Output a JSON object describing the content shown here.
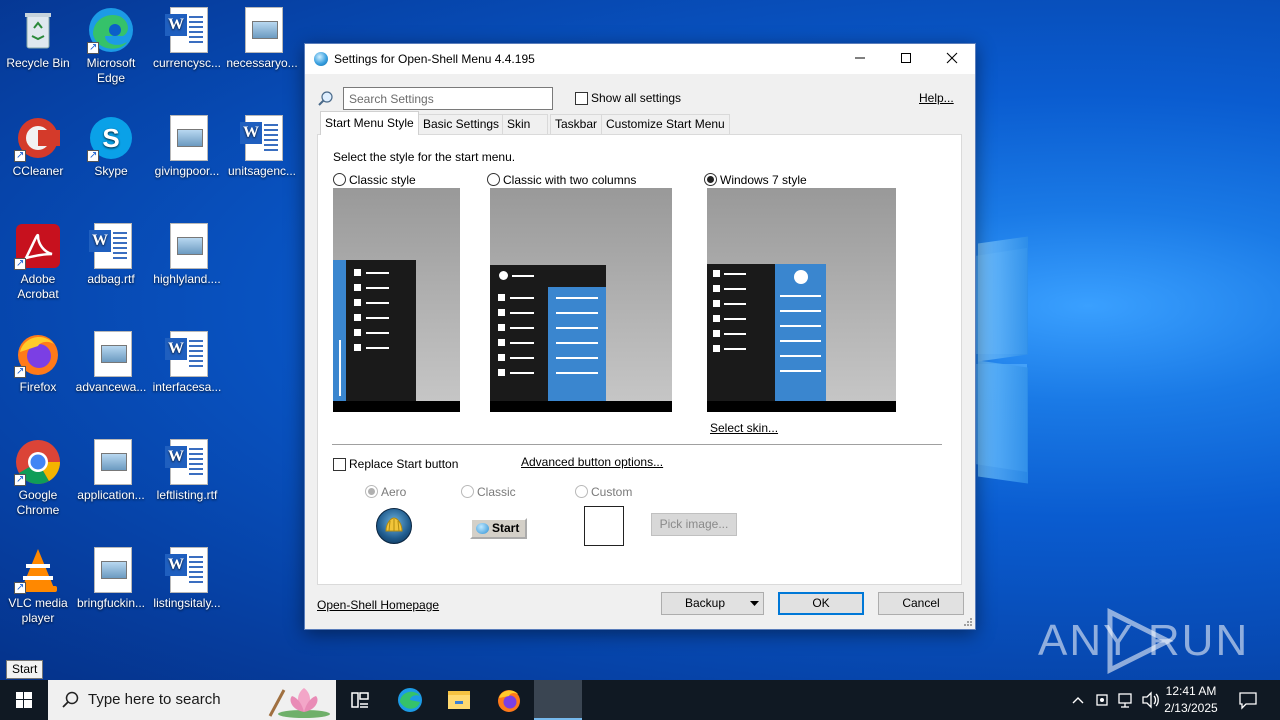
{
  "desktop": {
    "icons": [
      {
        "label": "Recycle Bin"
      },
      {
        "label": "Microsoft Edge"
      },
      {
        "label": "currencysc..."
      },
      {
        "label": "necessaryo..."
      },
      {
        "label": "CCleaner"
      },
      {
        "label": "Skype"
      },
      {
        "label": "givingpoor..."
      },
      {
        "label": "unitsagenc..."
      },
      {
        "label": "Adobe Acrobat"
      },
      {
        "label": "adbag.rtf"
      },
      {
        "label": "highlyland...."
      },
      {
        "label": "Firefox"
      },
      {
        "label": "advancewa..."
      },
      {
        "label": "interfacesa..."
      },
      {
        "label": "Google Chrome"
      },
      {
        "label": "application..."
      },
      {
        "label": "leftlisting.rtf"
      },
      {
        "label": "VLC media player"
      },
      {
        "label": "bringfuckin..."
      },
      {
        "label": "listingsitaly..."
      }
    ],
    "watermark": "ANY RUN"
  },
  "tooltip": {
    "start": "Start"
  },
  "taskbar": {
    "search_placeholder": "Type here to search",
    "clock_time": "12:41 AM",
    "clock_date": "2/13/2025"
  },
  "dialog": {
    "title": "Settings for Open-Shell Menu 4.4.195",
    "search_placeholder": "Search Settings",
    "show_all_settings": "Show all settings",
    "help": "Help...",
    "tabs": [
      {
        "label": "Start Menu Style"
      },
      {
        "label": "Basic Settings"
      },
      {
        "label": "Skin"
      },
      {
        "label": "Taskbar"
      },
      {
        "label": "Customize Start Menu"
      }
    ],
    "selected_tab": "Start Menu Style",
    "prompt": "Select the style for the start menu.",
    "styles": [
      {
        "label": "Classic style",
        "checked": false
      },
      {
        "label": "Classic with two columns",
        "checked": false
      },
      {
        "label": "Windows 7 style",
        "checked": true
      }
    ],
    "select_skin": "Select skin...",
    "replace_start_button": "Replace Start button",
    "advanced_button_options": "Advanced button options...",
    "button_styles": [
      {
        "label": "Aero",
        "checked": true
      },
      {
        "label": "Classic",
        "checked": false
      },
      {
        "label": "Custom",
        "checked": false
      }
    ],
    "classic_button_text": "Start",
    "pick_image": "Pick image...",
    "homepage_link": "Open-Shell Homepage",
    "backup": "Backup",
    "ok": "OK",
    "cancel": "Cancel"
  },
  "colors": {
    "accent_blue": "#3a86cf",
    "link": "#0046c8",
    "taskbar": "#101923"
  }
}
